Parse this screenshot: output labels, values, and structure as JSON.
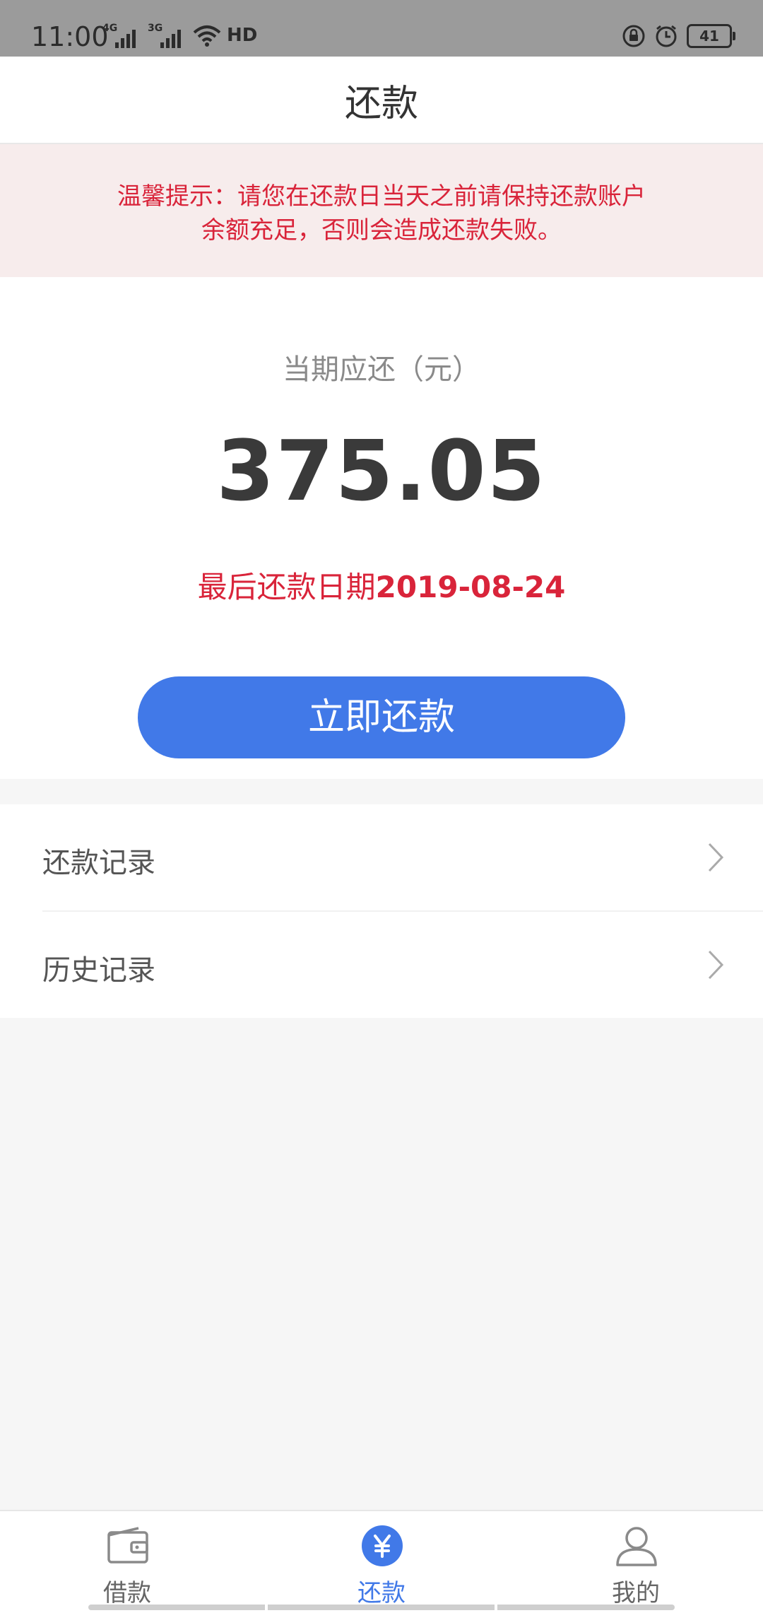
{
  "status_bar": {
    "time": "11:00",
    "network_1": "4G",
    "network_2": "3G",
    "data_label": "HD",
    "battery": "41"
  },
  "header": {
    "title": "还款"
  },
  "notice": {
    "line1": "温馨提示：请您在还款日当天之前请保持还款账户",
    "line2": "余额充足，否则会造成还款失败。"
  },
  "summary": {
    "label": "当期应还（元）",
    "amount": "375.05",
    "due_prefix": "最后还款日期",
    "due_date": "2019-08-24",
    "pay_button": "立即还款"
  },
  "menu": {
    "items": [
      {
        "label": "还款记录"
      },
      {
        "label": "历史记录"
      }
    ]
  },
  "bottom_nav": {
    "items": [
      {
        "label": "借款",
        "icon": "wallet-icon"
      },
      {
        "label": "还款",
        "icon": "yen-icon",
        "active": true
      },
      {
        "label": "我的",
        "icon": "user-icon"
      }
    ]
  },
  "colors": {
    "accent": "#4179e8",
    "alert": "#d9243a",
    "notice_bg": "#f7ecec"
  }
}
